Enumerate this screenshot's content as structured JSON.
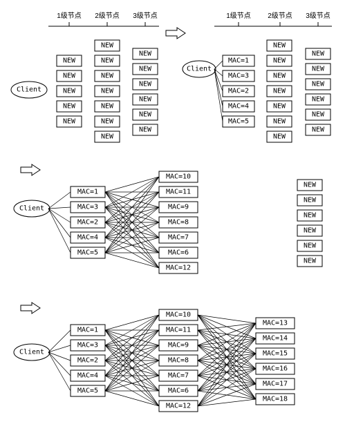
{
  "labels": {
    "tier1": "1级节点",
    "tier2": "2级节点",
    "tier3": "3级节点",
    "client": "Client",
    "new": "NEW"
  },
  "chart_data": [
    {
      "type": "diagram",
      "stage": 1,
      "client": true,
      "arrow_after": true,
      "tiers": [
        {
          "label": "1级节点",
          "nodes": [
            "NEW",
            "NEW",
            "NEW",
            "NEW",
            "NEW"
          ]
        },
        {
          "label": "2级节点",
          "nodes": [
            "NEW",
            "NEW",
            "NEW",
            "NEW",
            "NEW",
            "NEW",
            "NEW"
          ]
        },
        {
          "label": "3级节点",
          "nodes": [
            "NEW",
            "NEW",
            "NEW",
            "NEW",
            "NEW",
            "NEW"
          ]
        }
      ],
      "connections": []
    },
    {
      "type": "diagram",
      "stage": 2,
      "client": true,
      "tiers": [
        {
          "label": "1级节点",
          "nodes": [
            "MAC=1",
            "MAC=3",
            "MAC=2",
            "MAC=4",
            "MAC=5"
          ]
        },
        {
          "label": "2级节点",
          "nodes": [
            "NEW",
            "NEW",
            "NEW",
            "NEW",
            "NEW",
            "NEW",
            "NEW"
          ]
        },
        {
          "label": "3级节点",
          "nodes": [
            "NEW",
            "NEW",
            "NEW",
            "NEW",
            "NEW",
            "NEW"
          ]
        }
      ],
      "connections": {
        "client_to_t1": "all"
      }
    },
    {
      "type": "diagram",
      "stage": 3,
      "client": true,
      "arrow_before": true,
      "tiers": [
        {
          "label": "1级节点",
          "nodes": [
            "MAC=1",
            "MAC=3",
            "MAC=2",
            "MAC=4",
            "MAC=5"
          ]
        },
        {
          "label": "2级节点",
          "nodes": [
            "MAC=10",
            "MAC=11",
            "MAC=9",
            "MAC=8",
            "MAC=7",
            "MAC=6",
            "MAC=12"
          ]
        },
        {
          "label": "3级节点",
          "nodes": [
            "NEW",
            "NEW",
            "NEW",
            "NEW",
            "NEW",
            "NEW"
          ]
        }
      ],
      "connections": {
        "client_to_t1": "all",
        "t1_to_t2": "full"
      }
    },
    {
      "type": "diagram",
      "stage": 4,
      "client": true,
      "arrow_before": true,
      "tiers": [
        {
          "label": "1级节点",
          "nodes": [
            "MAC=1",
            "MAC=3",
            "MAC=2",
            "MAC=4",
            "MAC=5"
          ]
        },
        {
          "label": "2级节点",
          "nodes": [
            "MAC=10",
            "MAC=11",
            "MAC=9",
            "MAC=8",
            "MAC=7",
            "MAC=6",
            "MAC=12"
          ]
        },
        {
          "label": "3级节点",
          "nodes": [
            "MAC=13",
            "MAC=14",
            "MAC=15",
            "MAC=16",
            "MAC=17",
            "MAC=18"
          ]
        }
      ],
      "connections": {
        "client_to_t1": "all",
        "t1_to_t2": "full",
        "t2_to_t3": "full"
      }
    }
  ]
}
